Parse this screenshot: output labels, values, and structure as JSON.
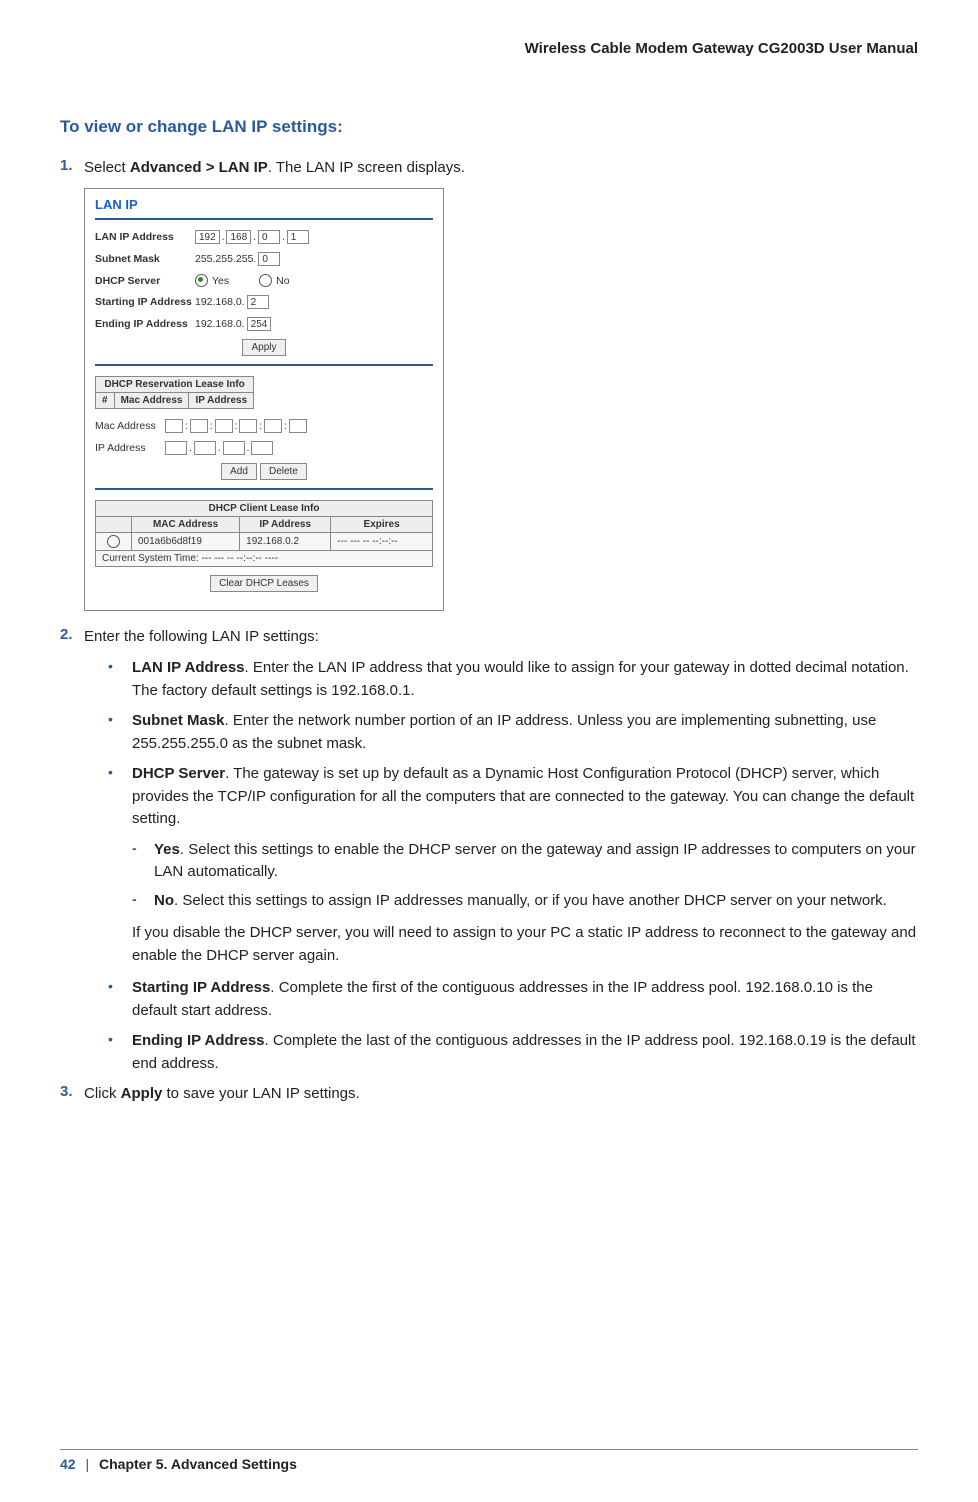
{
  "header": "Wireless Cable Modem Gateway CG2003D User Manual",
  "heading": "To view or change LAN IP settings:",
  "step1": {
    "num": "1.",
    "pre": "Select ",
    "bold": "Advanced > LAN IP",
    "post": ". The LAN IP screen displays."
  },
  "screenshot": {
    "title": "LAN IP",
    "lanip_label": "LAN IP Address",
    "lanip": {
      "a": "192",
      "b": "168",
      "c": "0",
      "d": "1"
    },
    "subnet_label": "Subnet Mask",
    "subnet_prefix": "255.255.255.",
    "subnet_last": "0",
    "dhcp_label": "DHCP Server",
    "dhcp_yes": "Yes",
    "dhcp_no": "No",
    "start_label": "Starting IP Address",
    "start_prefix": "192.168.0.",
    "start_last": "2",
    "end_label": "Ending IP Address",
    "end_prefix": "192.168.0.",
    "end_last": "254",
    "apply_btn": "Apply",
    "reservation_title": "DHCP Reservation Lease Info",
    "col_num": "#",
    "col_mac": "Mac Address",
    "col_ip": "IP Address",
    "mac_label": "Mac Address",
    "ip_label": "IP Address",
    "add_btn": "Add",
    "delete_btn": "Delete",
    "client_title": "DHCP Client Lease Info",
    "client_mac_h": "MAC Address",
    "client_ip_h": "IP Address",
    "client_exp_h": "Expires",
    "client_mac": "001a6b6d8f19",
    "client_ip": "192.168.0.2",
    "client_exp": "--- --- -- --:--:--",
    "systime_label": "Current System Time: --- --- -- --:--:-- ----",
    "clear_btn": "Clear DHCP Leases"
  },
  "step2": {
    "num": "2.",
    "text": "Enter the following LAN IP settings:"
  },
  "bullets": {
    "b1": {
      "bold": "LAN IP Address",
      "text": ". Enter the LAN IP address that you would like to assign for your gateway in dotted decimal notation. The factory default settings is 192.168.0.1."
    },
    "b2": {
      "bold": "Subnet Mask",
      "text": ". Enter the network number portion of an IP address. Unless you are implementing subnetting, use 255.255.255.0 as the subnet mask."
    },
    "b3": {
      "bold": "DHCP Server",
      "text": ". The gateway is set up by default as a Dynamic Host Configuration Protocol (DHCP) server, which provides the TCP/IP configuration for all the computers that are connected to the gateway. You can change the default setting."
    },
    "d_yes": {
      "bold": "Yes",
      "text": ". Select this settings to enable the DHCP server on the gateway and assign IP addresses to computers on your LAN automatically."
    },
    "d_no": {
      "bold": "No",
      "text": ". Select this settings to assign IP addresses manually, or if you have another DHCP server on your network."
    },
    "note": "If you disable the DHCP server, you will need to assign to your PC a static IP address to reconnect to the gateway and enable the DHCP server again.",
    "b4": {
      "bold": "Starting IP Address",
      "text": ". Complete the first of the contiguous addresses in the IP address pool. 192.168.0.10 is the default start address."
    },
    "b5": {
      "bold": "Ending IP Address",
      "text": ". Complete the last of the contiguous addresses in the IP address pool. 192.168.0.19 is the default end address."
    }
  },
  "step3": {
    "num": "3.",
    "pre": "Click ",
    "bold": "Apply",
    "post": " to save your LAN IP settings."
  },
  "footer": {
    "page": "42",
    "sep": "|",
    "chapter": "Chapter 5.  Advanced Settings"
  }
}
